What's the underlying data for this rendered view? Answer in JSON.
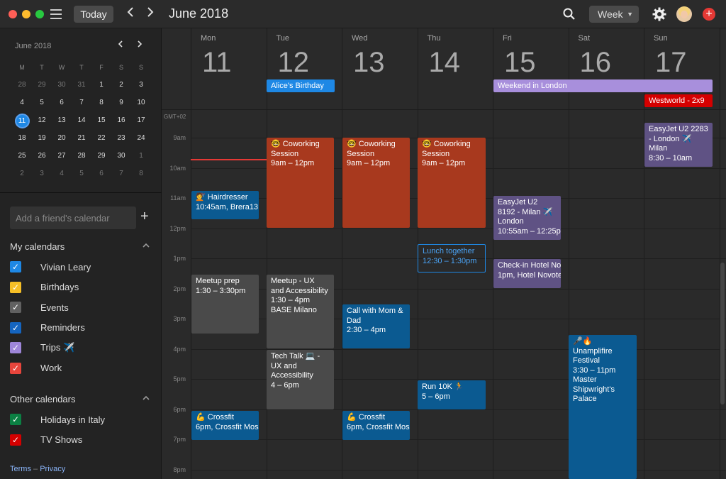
{
  "toolbar": {
    "today_label": "Today",
    "title": "June 2018",
    "view_label": "Week",
    "colors": {
      "close": "#ff5f57",
      "minimize": "#febc2e",
      "maximize": "#28c840"
    }
  },
  "mini_calendar": {
    "month_label": "June 2018",
    "weekday_headers": [
      "M",
      "T",
      "W",
      "T",
      "F",
      "S",
      "S"
    ],
    "weeks": [
      [
        "28",
        "29",
        "30",
        "31",
        "1",
        "2",
        "3"
      ],
      [
        "4",
        "5",
        "6",
        "7",
        "8",
        "9",
        "10"
      ],
      [
        "11",
        "12",
        "13",
        "14",
        "15",
        "16",
        "17"
      ],
      [
        "18",
        "19",
        "20",
        "21",
        "22",
        "23",
        "24"
      ],
      [
        "25",
        "26",
        "27",
        "28",
        "29",
        "30",
        "1"
      ],
      [
        "2",
        "3",
        "4",
        "5",
        "6",
        "7",
        "8"
      ]
    ],
    "today": "11"
  },
  "sidebar": {
    "friend_placeholder": "Add a friend's calendar",
    "my_calendars_title": "My calendars",
    "my_calendars": [
      {
        "label": "Vivian Leary",
        "color": "#1e88e5"
      },
      {
        "label": "Birthdays",
        "color": "#f6bf26"
      },
      {
        "label": "Events",
        "color": "#616161"
      },
      {
        "label": "Reminders",
        "color": "#1565c0"
      },
      {
        "label": "Trips ✈️",
        "color": "#9e86d9"
      },
      {
        "label": "Work",
        "color": "#e8453c"
      }
    ],
    "other_calendars_title": "Other calendars",
    "other_calendars": [
      {
        "label": "Holidays in Italy",
        "color": "#0b8043"
      },
      {
        "label": "TV Shows",
        "color": "#d50000"
      }
    ],
    "terms": "Terms",
    "privacy": "Privacy"
  },
  "week": {
    "days": [
      {
        "name": "Mon",
        "num": "11"
      },
      {
        "name": "Tue",
        "num": "12"
      },
      {
        "name": "Wed",
        "num": "13"
      },
      {
        "name": "Thu",
        "num": "14"
      },
      {
        "name": "Fri",
        "num": "15"
      },
      {
        "name": "Sat",
        "num": "16"
      },
      {
        "name": "Sun",
        "num": "17"
      }
    ],
    "timezone": "GMT+02",
    "hours": [
      "9am",
      "10am",
      "11am",
      "12pm",
      "1pm",
      "2pm",
      "3pm",
      "4pm",
      "5pm",
      "6pm",
      "7pm",
      "8pm"
    ]
  },
  "allday_events": {
    "alices_birthday": "Alice's Birthday",
    "weekend_london": "Weekend in London",
    "westworld": "Westworld - 2x9"
  },
  "events": {
    "coworking_tue": {
      "title": "🤓 Coworking Session",
      "time": "9am – 12pm"
    },
    "coworking_wed": {
      "title": "🤓 Coworking Session",
      "time": "9am – 12pm"
    },
    "coworking_thu": {
      "title": "🤓 Coworking Session",
      "time": "9am – 12pm"
    },
    "hairdresser": {
      "title": "💇 Hairdresser",
      "time": "10:45am, Brera13 I"
    },
    "easyjet_fri": {
      "title": "EasyJet U2 8192 - Milan ✈️ London",
      "time": "10:55am – 12:25p"
    },
    "easyjet_sun": {
      "title": "EasyJet U2 2283 - London ✈️ Milan",
      "time": "8:30 – 10am"
    },
    "lunch": {
      "title": "Lunch together",
      "time": "12:30 – 1:30pm"
    },
    "checkin": {
      "title": "Check-in Hotel Nov",
      "time": "1pm, Hotel Novote"
    },
    "meetup_prep": {
      "title": "Meetup prep",
      "time": "1:30 – 3:30pm"
    },
    "meetup_ux": {
      "title": "Meetup - UX and Accessibility",
      "time": "1:30 – 4pm",
      "location": "BASE Milano"
    },
    "call_mom": {
      "title": "Call with Mom & Dad",
      "time": "2:30 – 4pm"
    },
    "tech_talk": {
      "title": "Tech Talk 💻 - UX and Accessibility",
      "time": "4 – 6pm"
    },
    "unamplified": {
      "title": "🎤🔥 Unamplifire Festival",
      "time": "3:30 – 11pm",
      "location": "Master Shipwright's Palace"
    },
    "run": {
      "title": "Run 10K 🏃",
      "time": "5 – 6pm"
    },
    "crossfit_mon": {
      "title": "💪 Crossfit",
      "time": "6pm, Crossfit Mos"
    },
    "crossfit_wed": {
      "title": "💪 Crossfit",
      "time": "6pm, Crossfit Mos"
    }
  }
}
